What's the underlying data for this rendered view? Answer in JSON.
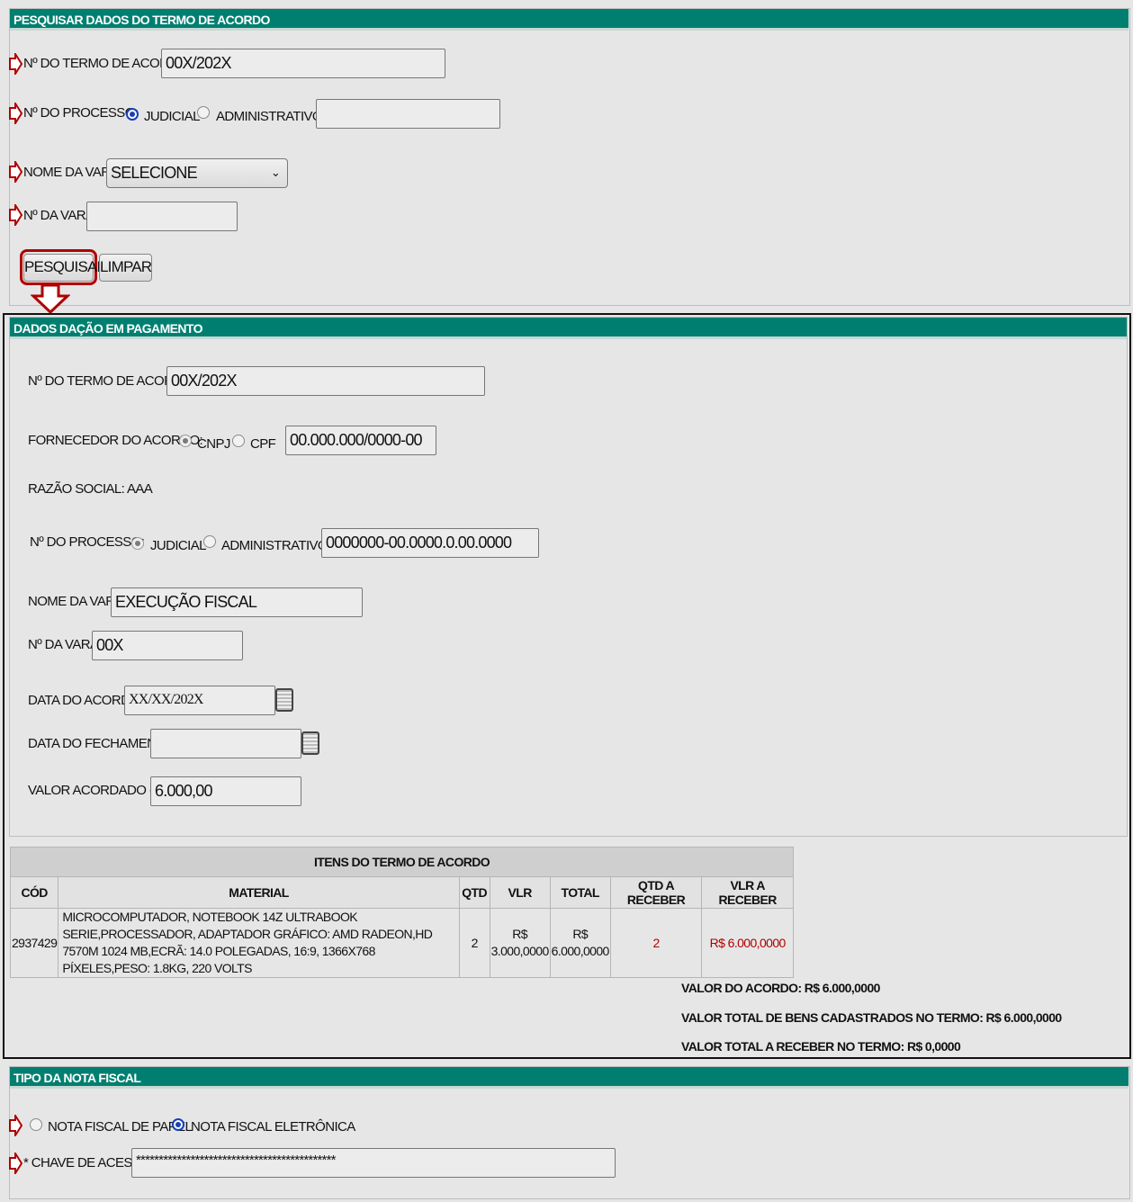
{
  "search": {
    "header": "PESQUISAR DADOS DO TERMO DE ACORDO",
    "termo_label": "Nº DO TERMO DE ACORDO:",
    "termo_value": "00X/202X",
    "processo_label": "Nº DO PROCESSO:",
    "judicial_label": "JUDICIAL",
    "administrativo_label": "ADMINISTRATIVO",
    "processo_value": "",
    "vara_label": "NOME DA VARA:",
    "vara_selected": "SELECIONE",
    "num_vara_label": "Nº DA VARA:",
    "num_vara_value": "",
    "pesquisar_label": "PESQUISAR",
    "limpar_label": "LIMPAR"
  },
  "dacao": {
    "header": "DADOS DAÇÃO EM PAGAMENTO",
    "termo_label": "Nº DO TERMO DE ACORDO:",
    "termo_value": "00X/202X",
    "fornecedor_label": "FORNECEDOR DO ACORDO:",
    "cnpj_label": "CNPJ",
    "cpf_label": "CPF",
    "fornecedor_value": "00.000.000/0000-00",
    "razao_social": "RAZÃO SOCIAL: AAA",
    "processo_label": "Nº DO PROCESSO:",
    "judicial_label": "JUDICIAL",
    "administrativo_label": "ADMINISTRATIVO",
    "processo_value": "0000000-00.0000.0.00.0000",
    "vara_label": "NOME DA VARA:",
    "vara_value": "EXECUÇÃO FISCAL",
    "num_vara_label": "Nº DA VARA:",
    "num_vara_value": "00X",
    "data_acordo_label": "DATA DO ACORDO:",
    "data_acordo_value": "XX/XX/202X",
    "data_fech_label": "DATA DO FECHAMENTO:",
    "data_fech_value": "",
    "valor_label": "VALOR ACORDADO (R$):",
    "valor_value": "6.000,00"
  },
  "items": {
    "title": "ITENS DO TERMO DE ACORDO",
    "columns": [
      "CÓD",
      "MATERIAL",
      "QTD",
      "VLR",
      "TOTAL",
      "QTD A RECEBER",
      "VLR A RECEBER"
    ],
    "rows": [
      {
        "cod": "2937429",
        "material": "MICROCOMPUTADOR, NOTEBOOK 14Z ULTRABOOK SERIE,PROCESSADOR, ADAPTADOR GRÁFICO: AMD RADEON,HD 7570M 1024 MB,ECRÃ: 14.0 POLEGADAS, 16:9, 1366X768 PÍXELES,PESO: 1.8KG, 220 VOLTS",
        "qtd": "2",
        "vlr_currency": "R$",
        "vlr": "3.000,0000",
        "total_currency": "R$",
        "total": "6.000,0000",
        "qtd_receber": "2",
        "vlr_receber": "R$ 6.000,0000"
      }
    ]
  },
  "summary": {
    "valor_acordo": "VALOR DO ACORDO: R$ 6.000,0000",
    "valor_bens": "VALOR TOTAL DE BENS CADASTRADOS NO TERMO: R$ 6.000,0000",
    "valor_receber": "VALOR TOTAL A RECEBER NO TERMO: R$ 0,0000"
  },
  "nota": {
    "header": "TIPO DA NOTA FISCAL",
    "papel_label": "NOTA FISCAL DE PAPEL",
    "eletronica_label": "NOTA FISCAL ELETRÔNICA",
    "chave_label": "* CHAVE DE ACESSO:",
    "chave_value": "********************************************"
  },
  "colors": {
    "header_bg": "#007f70",
    "arrow": "#b00000",
    "radio_selected": "#1a3fb8"
  }
}
